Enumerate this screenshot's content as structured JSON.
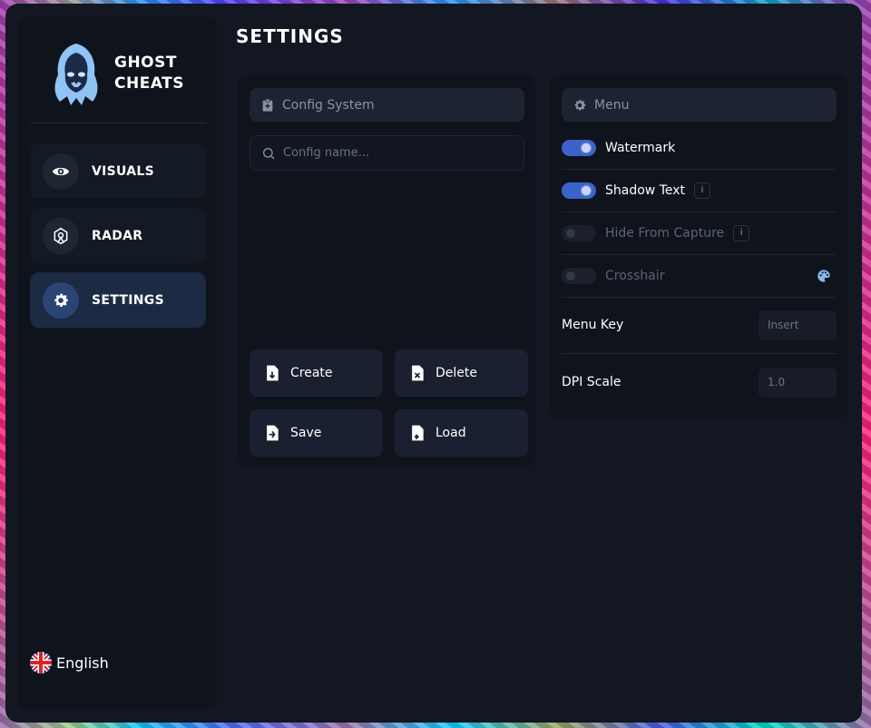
{
  "brand": {
    "line1": "GHOST",
    "line2": "CHEATS"
  },
  "nav": [
    {
      "label": "VISUALS",
      "icon": "eye-icon"
    },
    {
      "label": "RADAR",
      "icon": "radar-icon"
    },
    {
      "label": "SETTINGS",
      "icon": "gear-icon",
      "active": true
    }
  ],
  "language": {
    "label": "English",
    "icon": "uk-flag-icon"
  },
  "page": {
    "title": "SETTINGS"
  },
  "config": {
    "header": "Config System",
    "search_placeholder": "Config name...",
    "buttons": {
      "create": "Create",
      "delete": "Delete",
      "save": "Save",
      "load": "Load"
    }
  },
  "menu": {
    "header": "Menu",
    "options": [
      {
        "label": "Watermark",
        "enabled": true
      },
      {
        "label": "Shadow Text",
        "enabled": true,
        "info": "i"
      },
      {
        "label": "Hide From Capture",
        "enabled": false,
        "info": "i"
      },
      {
        "label": "Crosshair",
        "enabled": false
      }
    ],
    "menu_key": {
      "label": "Menu Key",
      "value": "Insert"
    },
    "dpi_scale": {
      "label": "DPI Scale",
      "value": "1.0"
    }
  },
  "colors": {
    "accent": "#3b63c9",
    "active_nav": "#1c2a44",
    "background": "#121722"
  }
}
